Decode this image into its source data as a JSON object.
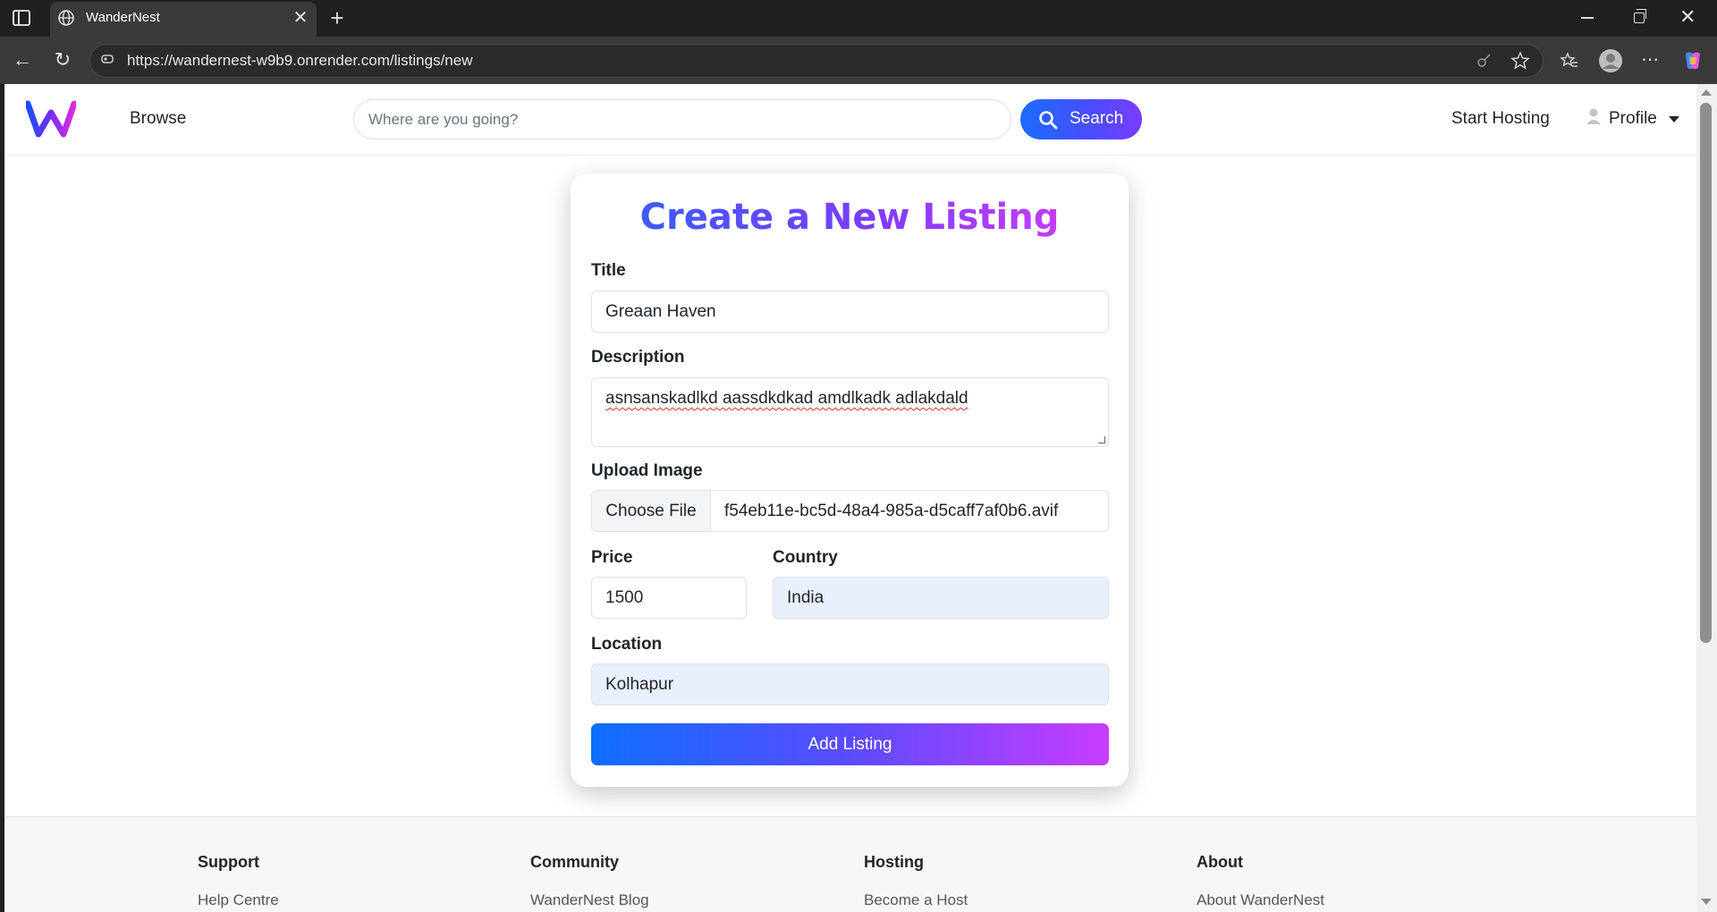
{
  "browser": {
    "tab_title": "WanderNest",
    "url": "https://wandernest-w9b9.onrender.com/listings/new"
  },
  "navbar": {
    "browse_label": "Browse",
    "search_placeholder": "Where are you going?",
    "search_button": "Search",
    "start_hosting": "Start Hosting",
    "profile_label": "Profile"
  },
  "form": {
    "heading": "Create a New Listing",
    "title_label": "Title",
    "title_value": "Greaan Haven",
    "description_label": "Description",
    "description_value": "asnsanskadlkd aassdkdkad amdlkadk adlakdald",
    "image_label": "Upload Image",
    "choose_file": "Choose File",
    "file_name": "f54eb11e-bc5d-48a4-985a-d5caff7af0b6.avif",
    "price_label": "Price",
    "price_value": "1500",
    "country_label": "Country",
    "country_value": "India",
    "location_label": "Location",
    "location_value": "Kolhapur",
    "submit": "Add Listing"
  },
  "footer": {
    "columns": [
      {
        "heading": "Support",
        "link": "Help Centre"
      },
      {
        "heading": "Community",
        "link": "WanderNest Blog"
      },
      {
        "heading": "Hosting",
        "link": "Become a Host"
      },
      {
        "heading": "About",
        "link": "About WanderNest"
      }
    ]
  },
  "colors": {
    "brand_start": "#0d6efd",
    "brand_end": "#c93cff",
    "autofill_bg": "#e8f0fe"
  }
}
